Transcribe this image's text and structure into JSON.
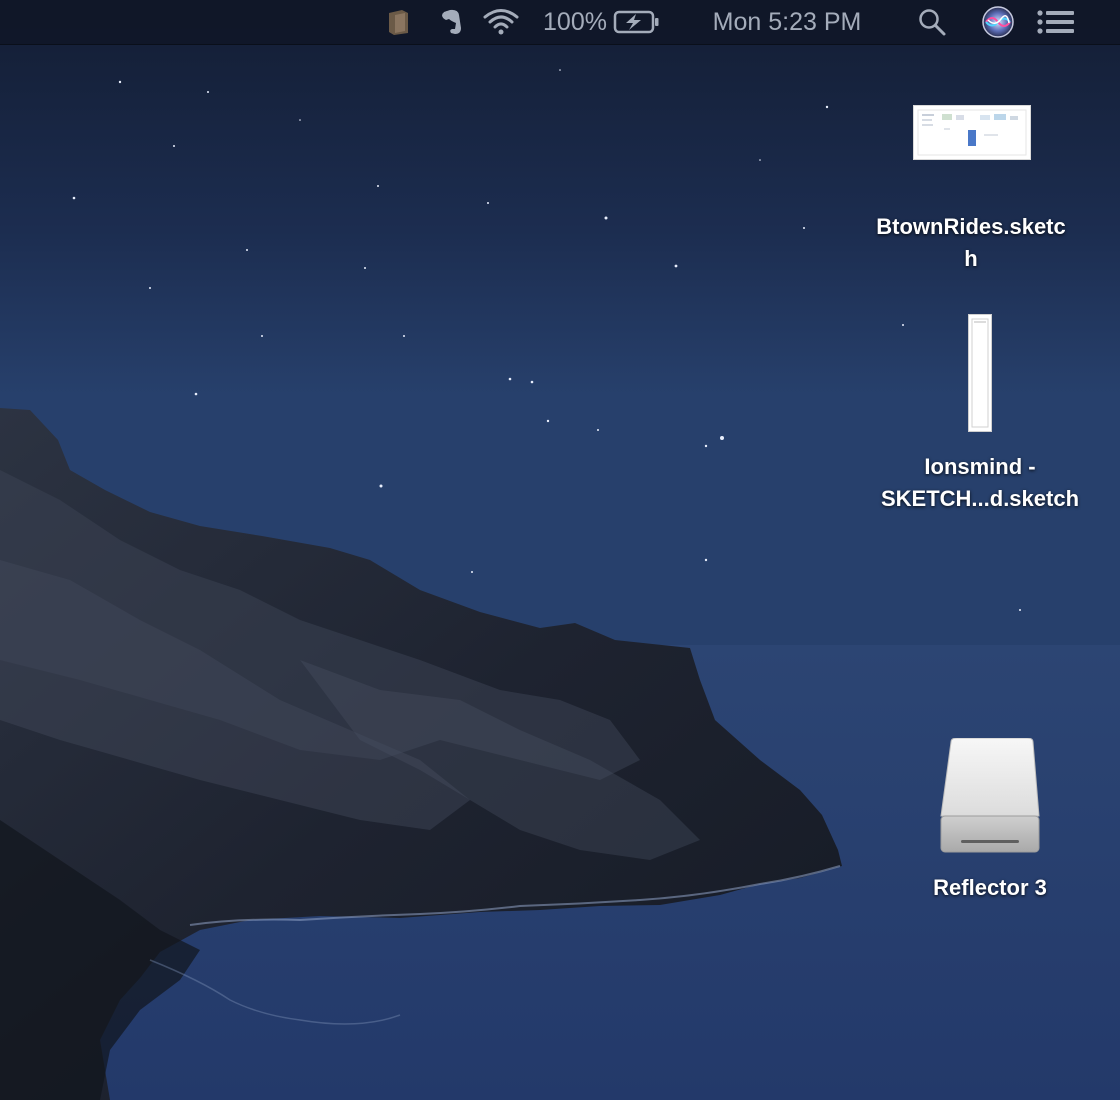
{
  "menubar": {
    "battery_percent": "100%",
    "clock": "Mon 5:23 PM",
    "icons": [
      "notebook-app-icon",
      "evernote-elephant-icon",
      "wifi-icon",
      "battery-charging-icon",
      "spotlight-search-icon",
      "siri-icon",
      "notification-center-icon"
    ]
  },
  "desktop": {
    "items": [
      {
        "label_line1": "BtownRides.sketc",
        "label_line2": "h",
        "kind": "sketch-document"
      },
      {
        "label_line1": "Ionsmind -",
        "label_line2": "SKETCH...d.sketch",
        "kind": "sketch-document"
      },
      {
        "label": "Reflector 3",
        "kind": "external-drive"
      }
    ]
  },
  "colors": {
    "sky_top": "#142038",
    "sea": "#2b4371",
    "menubar_text": "#a4acba",
    "label_text": "#ffffff"
  }
}
